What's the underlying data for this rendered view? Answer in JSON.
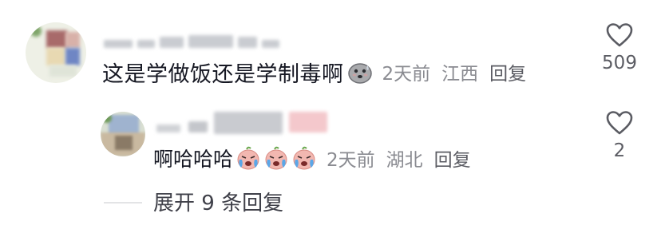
{
  "comment": {
    "text": "这是学做饭还是学制毒啊",
    "emoji": "gray-blob-sweat-emoji",
    "time": "2天前",
    "location": "江西",
    "reply_label": "回复",
    "likes": "509"
  },
  "reply": {
    "text": "啊哈哈哈",
    "emojis": [
      "crying-laughing-emoji",
      "crying-laughing-emoji",
      "crying-laughing-emoji"
    ],
    "time": "2天前",
    "location": "湖北",
    "reply_label": "回复",
    "likes": "2"
  },
  "expand": {
    "label": "展开 9 条回复"
  },
  "colors": {
    "text_primary": "#161823",
    "text_meta": "#8a8b91",
    "heart_outline": "#5b5c63"
  }
}
